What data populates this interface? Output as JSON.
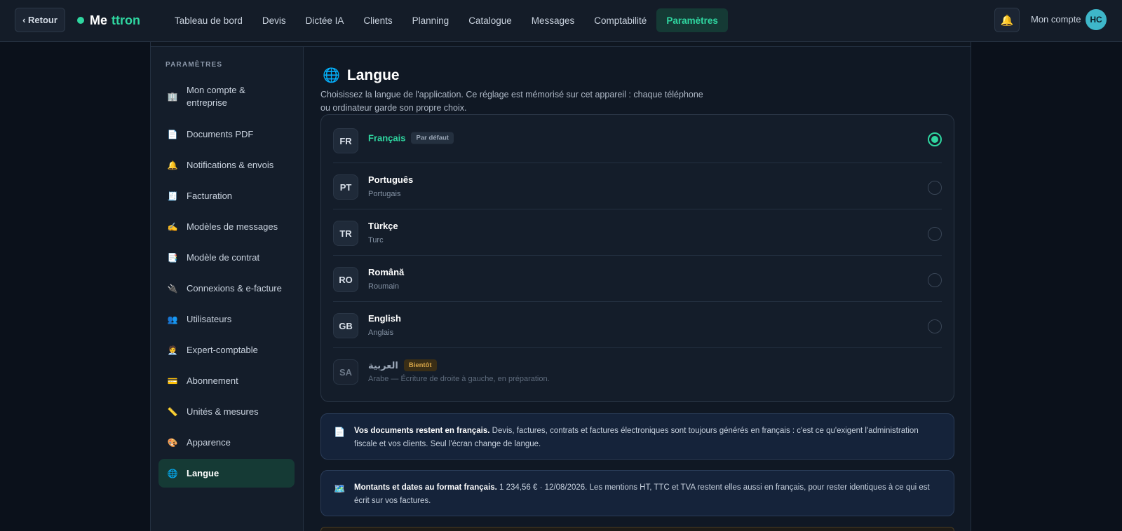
{
  "topbar": {
    "back_label": "‹ Retour",
    "brand_part1": "Me",
    "brand_part2": "ttron",
    "nav": [
      "Tableau de bord",
      "Devis",
      "Dictée IA",
      "Clients",
      "Planning",
      "Catalogue",
      "Messages",
      "Comptabilité",
      "Paramètres"
    ],
    "active_nav": "Paramètres",
    "bell_icon": "🔔",
    "account_label": "Mon compte",
    "avatar_initials": "HC"
  },
  "sidebar": {
    "heading": "PARAMÈTRES",
    "items": [
      {
        "icon": "🏢",
        "label": "Mon compte & entreprise",
        "active": false
      },
      {
        "icon": "📄",
        "label": "Documents PDF",
        "active": false
      },
      {
        "icon": "🔔",
        "label": "Notifications & envois",
        "active": false
      },
      {
        "icon": "🧾",
        "label": "Facturation",
        "active": false
      },
      {
        "icon": "✍️",
        "label": "Modèles de messages",
        "active": false
      },
      {
        "icon": "📑",
        "label": "Modèle de contrat",
        "active": false
      },
      {
        "icon": "🔌",
        "label": "Connexions & e-facture",
        "active": false
      },
      {
        "icon": "👥",
        "label": "Utilisateurs",
        "active": false
      },
      {
        "icon": "🧑‍💼",
        "label": "Expert-comptable",
        "active": false
      },
      {
        "icon": "💳",
        "label": "Abonnement",
        "active": false
      },
      {
        "icon": "📏",
        "label": "Unités & mesures",
        "active": false
      },
      {
        "icon": "🎨",
        "label": "Apparence",
        "active": false
      },
      {
        "icon": "🌐",
        "label": "Langue",
        "active": true
      }
    ]
  },
  "content": {
    "title_icon": "🌐",
    "title": "Langue",
    "description": "Choisissez la langue de l'application. Ce réglage est mémorisé sur cet appareil : chaque téléphone ou ordinateur garde son propre choix.",
    "languages": [
      {
        "code": "FR",
        "name": "Français",
        "sub": "",
        "badge": "Par défaut",
        "selected": true,
        "disabled": false
      },
      {
        "code": "PT",
        "name": "Português",
        "sub": "Portugais",
        "badge": "",
        "selected": false,
        "disabled": false
      },
      {
        "code": "TR",
        "name": "Türkçe",
        "sub": "Turc",
        "badge": "",
        "selected": false,
        "disabled": false
      },
      {
        "code": "RO",
        "name": "Română",
        "sub": "Roumain",
        "badge": "",
        "selected": false,
        "disabled": false
      },
      {
        "code": "GB",
        "name": "English",
        "sub": "Anglais",
        "badge": "",
        "selected": false,
        "disabled": false
      },
      {
        "code": "SA",
        "name": "العربية",
        "sub": "Arabe — Écriture de droite à gauche, en préparation.",
        "badge": "Bientôt",
        "selected": false,
        "disabled": true
      }
    ],
    "info_documents": {
      "icon": "📄",
      "bold": "Vos documents restent en français.",
      "text": " Devis, factures, contrats et factures électroniques sont toujours générés en français : c'est ce qu'exigent l'administration fiscale et vos clients. Seul l'écran change de langue."
    },
    "info_formats": {
      "icon": "🗺️",
      "bold": "Montants et dates au format français.",
      "text": " 1 234,56 € · 12/08/2026. Les mentions HT, TTC et TVA restent elles aussi en français, pour rester identiques à ce qui est écrit sur vos factures."
    }
  }
}
